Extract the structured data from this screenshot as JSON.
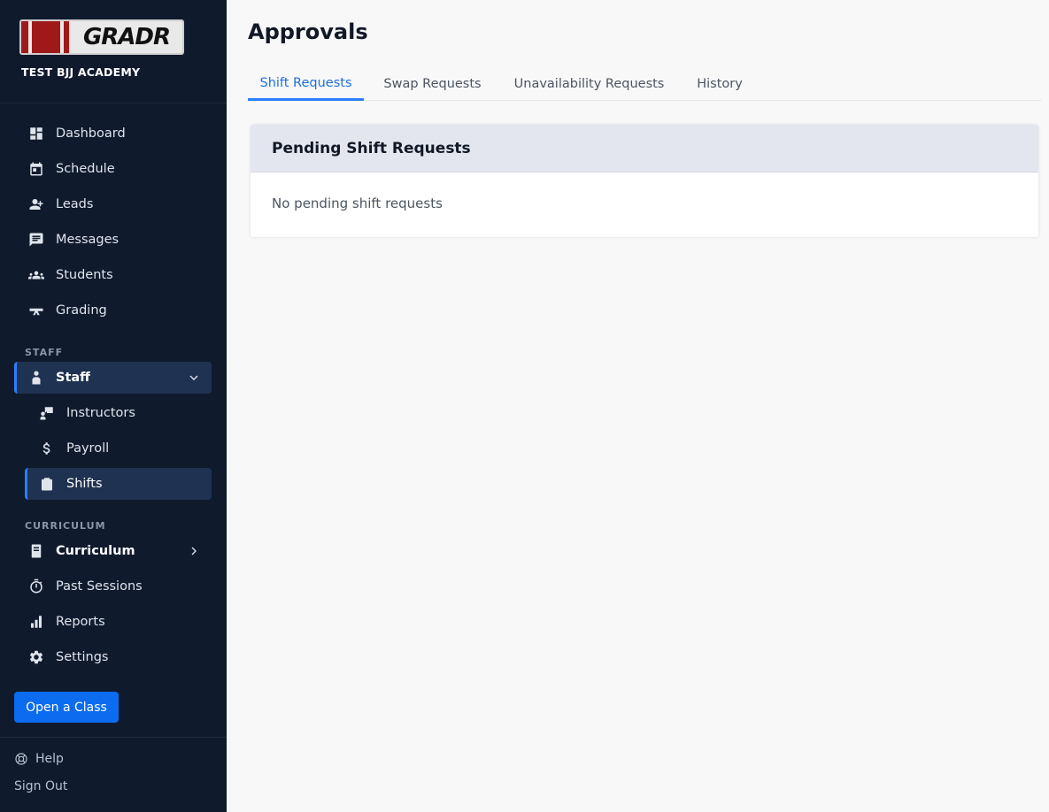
{
  "brand": {
    "logo_text": "GRADR",
    "academy_name": "TEST BJJ ACADEMY"
  },
  "sidebar": {
    "main_items": [
      {
        "label": "Dashboard",
        "icon": "dashboard-icon"
      },
      {
        "label": "Schedule",
        "icon": "calendar-icon"
      },
      {
        "label": "Leads",
        "icon": "person-add-icon"
      },
      {
        "label": "Messages",
        "icon": "chat-icon"
      },
      {
        "label": "Students",
        "icon": "group-icon"
      },
      {
        "label": "Grading",
        "icon": "belt-icon"
      }
    ],
    "staff_section_label": "STAFF",
    "staff_item": {
      "label": "Staff",
      "icon": "person-icon",
      "expanded": true
    },
    "staff_sub_items": [
      {
        "label": "Instructors",
        "icon": "instructor-icon"
      },
      {
        "label": "Payroll",
        "icon": "dollar-icon"
      },
      {
        "label": "Shifts",
        "icon": "clipboard-icon",
        "active": true
      }
    ],
    "curriculum_section_label": "CURRICULUM",
    "curriculum_item": {
      "label": "Curriculum",
      "icon": "book-icon"
    },
    "other_items": [
      {
        "label": "Past Sessions",
        "icon": "stopwatch-icon"
      },
      {
        "label": "Reports",
        "icon": "bar-chart-icon"
      },
      {
        "label": "Settings",
        "icon": "gear-icon"
      }
    ],
    "open_class_label": "Open a Class",
    "help_label": "Help",
    "signout_label": "Sign Out"
  },
  "main": {
    "title": "Approvals",
    "tabs": [
      {
        "label": "Shift Requests",
        "active": true
      },
      {
        "label": "Swap Requests"
      },
      {
        "label": "Unavailability Requests"
      },
      {
        "label": "History"
      }
    ],
    "card": {
      "header": "Pending Shift Requests",
      "empty_message": "No pending shift requests"
    }
  },
  "colors": {
    "sidebar_bg": "#0f1a2d",
    "accent": "#2b7fff",
    "button": "#0b6cf0",
    "active_bg": "#1f3252"
  }
}
